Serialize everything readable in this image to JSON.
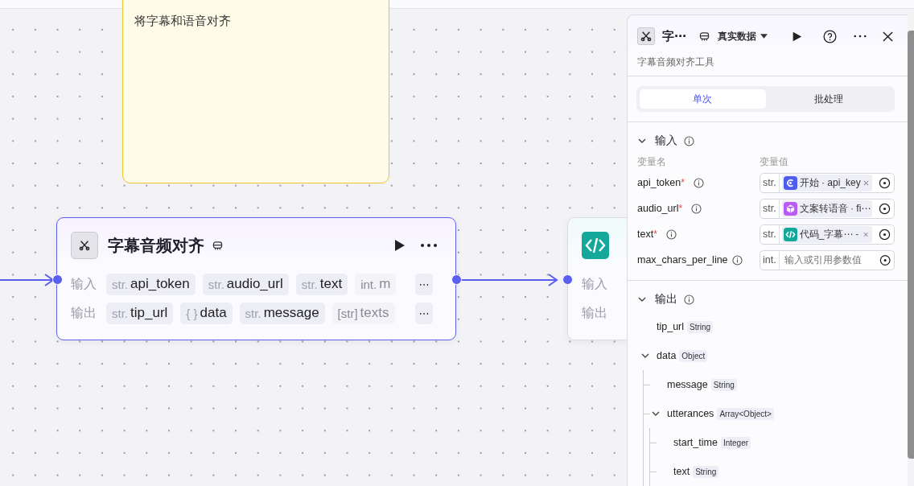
{
  "note": {
    "text": "将字幕和语音对齐"
  },
  "nodes": [
    {
      "kind": "tool",
      "title": "字幕音频对齐",
      "selected": true,
      "input_label": "输入",
      "output_label": "输出",
      "inputs": [
        {
          "type": "str.",
          "name": "api_token",
          "faded": false
        },
        {
          "type": "str.",
          "name": "audio_url",
          "faded": false
        },
        {
          "type": "str.",
          "name": "text",
          "faded": false
        },
        {
          "type": "int.",
          "name": "m",
          "faded": true
        }
      ],
      "outputs": [
        {
          "type": "str.",
          "name": "tip_url",
          "faded": false
        },
        {
          "type": "{ }",
          "name": "data",
          "faded": false
        },
        {
          "type": "str.",
          "name": "message",
          "faded": false
        },
        {
          "type": "[str]",
          "name": "texts",
          "faded": true
        }
      ],
      "more": "⋯"
    },
    {
      "kind": "code",
      "selected": false,
      "input_label": "输入",
      "output_label": "输出"
    }
  ],
  "panel": {
    "title": "字⋯",
    "data_source": "真实数据",
    "subtitle": "字幕音频对齐工具",
    "tabs": [
      {
        "label": "单次",
        "selected": true
      },
      {
        "label": "批处理",
        "selected": false
      }
    ],
    "input_section": {
      "title": "输入",
      "expanded": true,
      "col_name": "变量名",
      "col_value": "变量值",
      "required_mark": "*",
      "params": [
        {
          "name": "api_token",
          "required": true,
          "type": "str.",
          "ref": {
            "kind": "start",
            "text": "开始 · api_key"
          }
        },
        {
          "name": "audio_url",
          "required": true,
          "type": "str.",
          "ref": {
            "kind": "tts",
            "text": "文案转语音 · fi⋯"
          }
        },
        {
          "name": "text",
          "required": true,
          "type": "str.",
          "ref": {
            "kind": "code",
            "text": "代码_字幕⋯",
            "suffix": "-"
          }
        },
        {
          "name": "max_chars_per_line",
          "required": false,
          "type": "int.",
          "placeholder": "输入或引用参数值"
        }
      ]
    },
    "output_section": {
      "title": "输出",
      "expanded": true,
      "fields": [
        {
          "name": "tip_url",
          "type": "String"
        },
        {
          "name": "data",
          "type": "Object",
          "expanded": true,
          "children": [
            {
              "name": "message",
              "type": "String"
            },
            {
              "name": "utterances",
              "type": "Array<Object>",
              "expanded": true,
              "children": [
                {
                  "name": "start_time",
                  "type": "Integer"
                },
                {
                  "name": "text",
                  "type": "String"
                }
              ]
            }
          ]
        }
      ]
    }
  }
}
